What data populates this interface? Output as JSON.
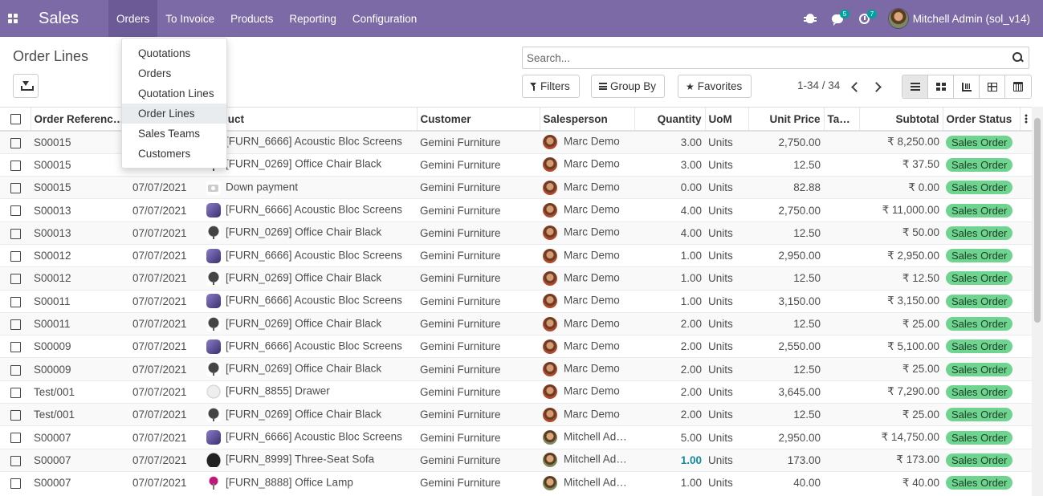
{
  "navbar": {
    "app_title": "Sales",
    "menu": [
      "Orders",
      "To Invoice",
      "Products",
      "Reporting",
      "Configuration"
    ],
    "messages_count": "5",
    "activities_count": "7",
    "user_name": "Mitchell Admin (sol_v14)",
    "bg_color": "#7c6aa6"
  },
  "dropdown": {
    "items": [
      "Quotations",
      "Orders",
      "Quotation Lines",
      "Order Lines",
      "Sales Teams",
      "Customers"
    ],
    "active": "Order Lines"
  },
  "control_panel": {
    "title": "Order Lines",
    "search_placeholder": "Search...",
    "filters_label": "Filters",
    "group_by_label": "Group By",
    "favorites_label": "Favorites",
    "pager": "1-34 / 34"
  },
  "table": {
    "headers": [
      "Order Referenc…",
      "",
      "duct",
      "Customer",
      "Salesperson",
      "Quantity",
      "UoM",
      "Unit Price",
      "Tax…",
      "Subtotal",
      "Order Status"
    ],
    "rows": [
      {
        "ref": "S00015",
        "date": "",
        "product": "[FURN_6666] Acoustic Bloc Screens",
        "thumb": "screen",
        "customer": "Gemini Furniture",
        "salesperson": "Marc Demo",
        "qty": "3.00",
        "uom": "Units",
        "price": "2,750.00",
        "subtotal": "₹ 8,250.00",
        "status": "Sales Order"
      },
      {
        "ref": "S00015",
        "date": "",
        "product": "[FURN_0269] Office Chair Black",
        "thumb": "chair",
        "customer": "Gemini Furniture",
        "salesperson": "Marc Demo",
        "qty": "3.00",
        "uom": "Units",
        "price": "12.50",
        "subtotal": "₹ 37.50",
        "status": "Sales Order"
      },
      {
        "ref": "S00015",
        "date": "07/07/2021",
        "product": "Down payment",
        "thumb": "camera",
        "customer": "Gemini Furniture",
        "salesperson": "Marc Demo",
        "qty": "0.00",
        "uom": "Units",
        "price": "82.88",
        "subtotal": "₹ 0.00",
        "status": "Sales Order"
      },
      {
        "ref": "S00013",
        "date": "07/07/2021",
        "product": "[FURN_6666] Acoustic Bloc Screens",
        "thumb": "screen",
        "customer": "Gemini Furniture",
        "salesperson": "Marc Demo",
        "qty": "4.00",
        "uom": "Units",
        "price": "2,750.00",
        "subtotal": "₹ 11,000.00",
        "status": "Sales Order"
      },
      {
        "ref": "S00013",
        "date": "07/07/2021",
        "product": "[FURN_0269] Office Chair Black",
        "thumb": "chair",
        "customer": "Gemini Furniture",
        "salesperson": "Marc Demo",
        "qty": "4.00",
        "uom": "Units",
        "price": "12.50",
        "subtotal": "₹ 50.00",
        "status": "Sales Order"
      },
      {
        "ref": "S00012",
        "date": "07/07/2021",
        "product": "[FURN_6666] Acoustic Bloc Screens",
        "thumb": "screen",
        "customer": "Gemini Furniture",
        "salesperson": "Marc Demo",
        "qty": "1.00",
        "uom": "Units",
        "price": "2,950.00",
        "subtotal": "₹ 2,950.00",
        "status": "Sales Order"
      },
      {
        "ref": "S00012",
        "date": "07/07/2021",
        "product": "[FURN_0269] Office Chair Black",
        "thumb": "chair",
        "customer": "Gemini Furniture",
        "salesperson": "Marc Demo",
        "qty": "1.00",
        "uom": "Units",
        "price": "12.50",
        "subtotal": "₹ 12.50",
        "status": "Sales Order"
      },
      {
        "ref": "S00011",
        "date": "07/07/2021",
        "product": "[FURN_6666] Acoustic Bloc Screens",
        "thumb": "screen",
        "customer": "Gemini Furniture",
        "salesperson": "Marc Demo",
        "qty": "1.00",
        "uom": "Units",
        "price": "3,150.00",
        "subtotal": "₹ 3,150.00",
        "status": "Sales Order"
      },
      {
        "ref": "S00011",
        "date": "07/07/2021",
        "product": "[FURN_0269] Office Chair Black",
        "thumb": "chair",
        "customer": "Gemini Furniture",
        "salesperson": "Marc Demo",
        "qty": "2.00",
        "uom": "Units",
        "price": "12.50",
        "subtotal": "₹ 25.00",
        "status": "Sales Order"
      },
      {
        "ref": "S00009",
        "date": "07/07/2021",
        "product": "[FURN_6666] Acoustic Bloc Screens",
        "thumb": "screen",
        "customer": "Gemini Furniture",
        "salesperson": "Marc Demo",
        "qty": "2.00",
        "uom": "Units",
        "price": "2,550.00",
        "subtotal": "₹ 5,100.00",
        "status": "Sales Order"
      },
      {
        "ref": "S00009",
        "date": "07/07/2021",
        "product": "[FURN_0269] Office Chair Black",
        "thumb": "chair",
        "customer": "Gemini Furniture",
        "salesperson": "Marc Demo",
        "qty": "2.00",
        "uom": "Units",
        "price": "12.50",
        "subtotal": "₹ 25.00",
        "status": "Sales Order"
      },
      {
        "ref": "Test/001",
        "date": "07/07/2021",
        "product": "[FURN_8855] Drawer",
        "thumb": "drawer",
        "customer": "Gemini Furniture",
        "salesperson": "Marc Demo",
        "qty": "2.00",
        "uom": "Units",
        "price": "3,645.00",
        "subtotal": "₹ 7,290.00",
        "status": "Sales Order"
      },
      {
        "ref": "Test/001",
        "date": "07/07/2021",
        "product": "[FURN_0269] Office Chair Black",
        "thumb": "chair",
        "customer": "Gemini Furniture",
        "salesperson": "Marc Demo",
        "qty": "2.00",
        "uom": "Units",
        "price": "12.50",
        "subtotal": "₹ 25.00",
        "status": "Sales Order"
      },
      {
        "ref": "S00007",
        "date": "07/07/2021",
        "product": "[FURN_6666] Acoustic Bloc Screens",
        "thumb": "screen",
        "customer": "Gemini Furniture",
        "salesperson": "Mitchell Admin",
        "qty": "5.00",
        "uom": "Units",
        "price": "2,950.00",
        "subtotal": "₹ 14,750.00",
        "status": "Sales Order"
      },
      {
        "ref": "S00007",
        "date": "07/07/2021",
        "product": "[FURN_8999] Three-Seat Sofa",
        "thumb": "sofa",
        "customer": "Gemini Furniture",
        "salesperson": "Mitchell Admin",
        "qty": "1.00",
        "qty_highlight": true,
        "uom": "Units",
        "price": "173.00",
        "subtotal": "₹ 173.00",
        "status": "Sales Order"
      },
      {
        "ref": "S00007",
        "date": "07/07/2021",
        "product": "[FURN_8888] Office Lamp",
        "thumb": "lamp",
        "customer": "Gemini Furniture",
        "salesperson": "Mitchell Admin",
        "qty": "1.00",
        "uom": "Units",
        "price": "40.00",
        "subtotal": "₹ 40.00",
        "status": "Sales Order"
      }
    ]
  },
  "colors": {
    "status_badge": "#6fd48f",
    "highlight_qty": "#0f8a9f"
  }
}
